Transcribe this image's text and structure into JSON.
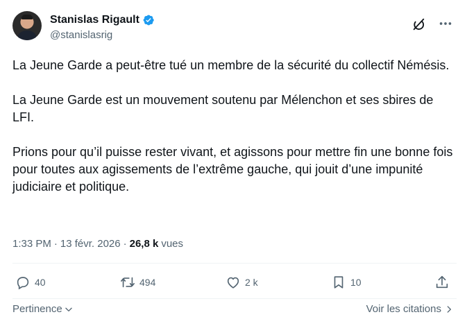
{
  "author": {
    "display_name": "Stanislas Rigault",
    "handle": "@stanislasrig"
  },
  "tweet": {
    "paragraphs": [
      "La Jeune Garde a peut-être tué un membre de la sécurité du collectif Némésis.",
      "La Jeune Garde est un mouvement soutenu par Mélenchon et ses sbires de LFI.",
      "Prions pour qu’il puisse rester vivant, et agissons pour mettre fin une bonne fois pour toutes aux agissements de l’extrême gauche, qui jouit d’une impunité judiciaire et politique."
    ]
  },
  "meta": {
    "time": "1:33 PM",
    "separator": "·",
    "date": "13 févr. 2026",
    "separator2": "·",
    "views_count": "26,8 k",
    "views_label": "vues"
  },
  "actions": {
    "replies": "40",
    "reposts": "494",
    "likes": "2 k",
    "bookmarks": "10"
  },
  "footer": {
    "sort_label": "Pertinence",
    "quotes_label": "Voir les citations"
  },
  "colors": {
    "text": "#0f1419",
    "secondary": "#536471",
    "verified": "#1d9bf0",
    "divider": "#eff3f4"
  }
}
